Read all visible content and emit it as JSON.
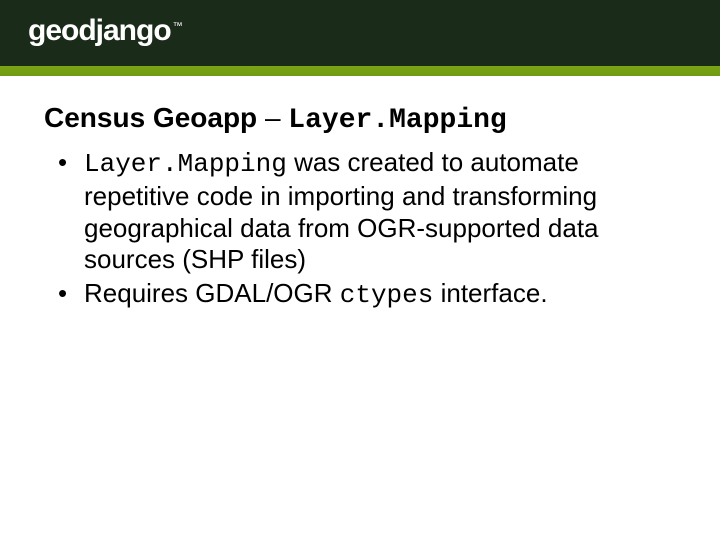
{
  "header": {
    "logo_text": "geodjango",
    "logo_tm": "™"
  },
  "title": {
    "prefix": "Census Geoapp ",
    "dash": "– ",
    "mono": "Layer.Mapping"
  },
  "bullets": [
    {
      "mono_lead": "Layer.Mapping",
      "rest": " was created to automate repetitive code in importing and transforming geographical data from OGR-supported data sources (SHP files)"
    },
    {
      "text_before": "Requires GDAL/OGR ",
      "mono": "ctypes",
      "text_after": " interface."
    }
  ]
}
